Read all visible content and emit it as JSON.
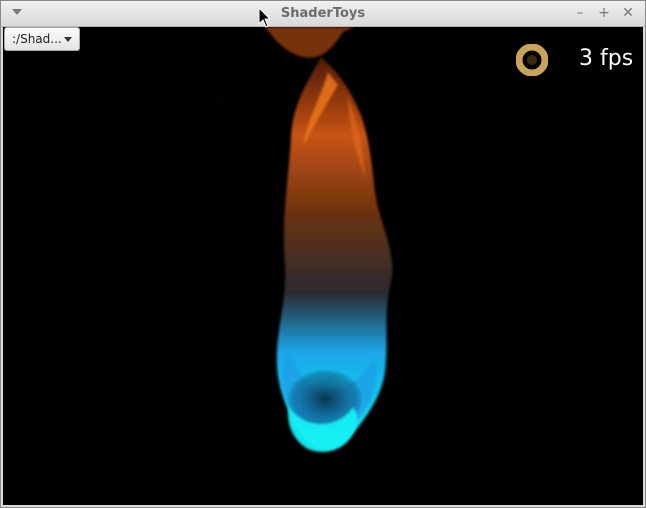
{
  "window": {
    "title": "ShaderToys",
    "controls": {
      "minimize": "–",
      "maximize": "+",
      "close": "✕"
    }
  },
  "toolbar": {
    "shader_select": {
      "value": ":/Shad..."
    }
  },
  "overlay": {
    "fps_text": "3 fps",
    "fps_icon": "ring-icon"
  },
  "colors": {
    "canvas_bg": "#000000",
    "flame_orange": "#d9651a",
    "flame_blue": "#18b8ff",
    "flame_cyan": "#19f0f5",
    "icon_gold": "#c8a55a"
  }
}
